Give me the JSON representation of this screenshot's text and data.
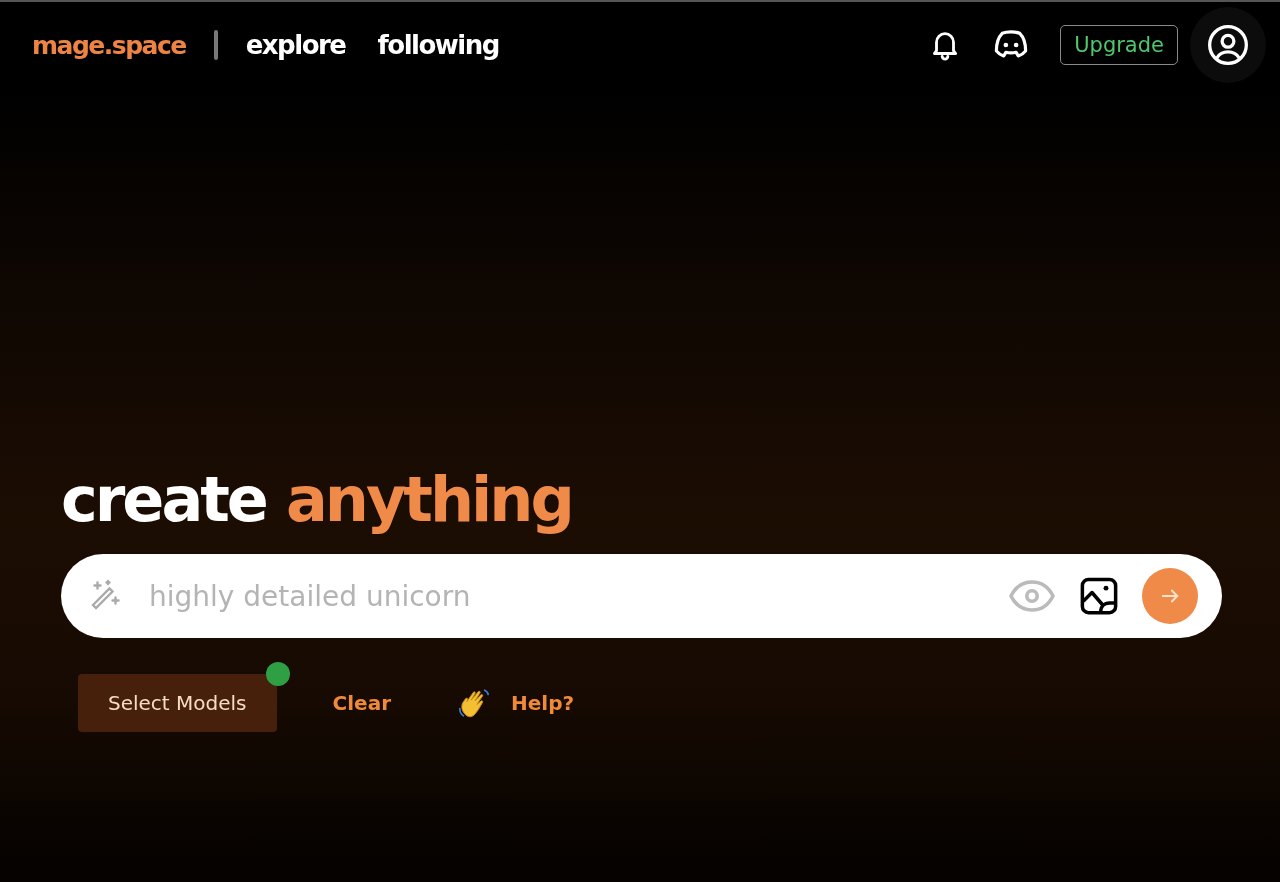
{
  "header": {
    "logo": "mage.space",
    "nav": [
      {
        "label": "explore"
      },
      {
        "label": "following"
      }
    ],
    "upgrade": "Upgrade"
  },
  "hero": {
    "title_parts": [
      {
        "text": "create",
        "accent": false
      },
      {
        "text": "anything",
        "accent": true
      }
    ]
  },
  "prompt": {
    "placeholder": "highly detailed unicorn"
  },
  "actions": [
    {
      "kind": "primary",
      "label": "Select Models",
      "badge": true
    },
    {
      "kind": "link",
      "label": "Clear"
    },
    {
      "kind": "wave-link",
      "label": "Help?"
    }
  ]
}
